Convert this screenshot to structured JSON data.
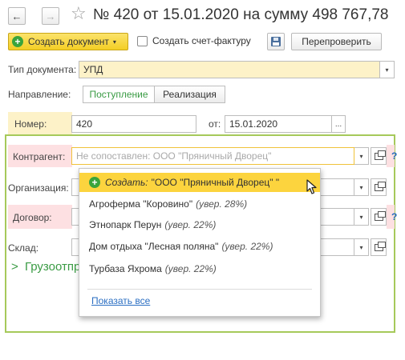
{
  "header": {
    "back_glyph": "←",
    "forward_glyph": "→",
    "star_glyph": "☆",
    "title": "№ 420 от 15.01.2020 на сумму 498 767,78"
  },
  "toolbar": {
    "create_label": "Создать документ",
    "create_arrow": "▾",
    "invoice_checkbox_label": "Создать счет-фактуру",
    "invoice_checked": false,
    "recheck_label": "Перепроверить"
  },
  "form": {
    "doc_type": {
      "label": "Тип документа:",
      "value": "УПД"
    },
    "direction": {
      "label": "Направление:",
      "options": [
        "Поступление",
        "Реализация"
      ],
      "selected": "Поступление"
    },
    "number": {
      "label": "Номер:",
      "value": "420"
    },
    "date": {
      "label": "от:",
      "value": "15.01.2020",
      "button": "..."
    },
    "counterparty": {
      "label": "Контрагент:",
      "placeholder": "Не сопоставлен: ООО \"Пряничный Дворец\""
    },
    "organization": {
      "label": "Организация:"
    },
    "contract": {
      "label": "Договор:"
    },
    "warehouse": {
      "label": "Склад:"
    },
    "section": {
      "chevron": ">",
      "label": "Грузоотпр"
    },
    "help": "?"
  },
  "dropdown": {
    "create_prefix": "Создать:",
    "create_value": "\"ООО \"Пряничный Дворец\" \"",
    "items": [
      {
        "name": "Агроферма \"Коровино\"",
        "confidence": "(увер. 28%)"
      },
      {
        "name": "Этнопарк Перун",
        "confidence": "(увер. 22%)"
      },
      {
        "name": "Дом отдыха \"Лесная поляна\"",
        "confidence": "(увер. 22%)"
      },
      {
        "name": "Турбаза Яхрома",
        "confidence": "(увер. 22%)"
      }
    ],
    "show_all": "Показать все"
  },
  "colors": {
    "accent_yellow": "#f4cf25",
    "required_pink": "#fde0e2",
    "frame_green": "#a6c95a",
    "link_blue": "#2a6ec2",
    "selected_green_text": "#3a9b44"
  }
}
